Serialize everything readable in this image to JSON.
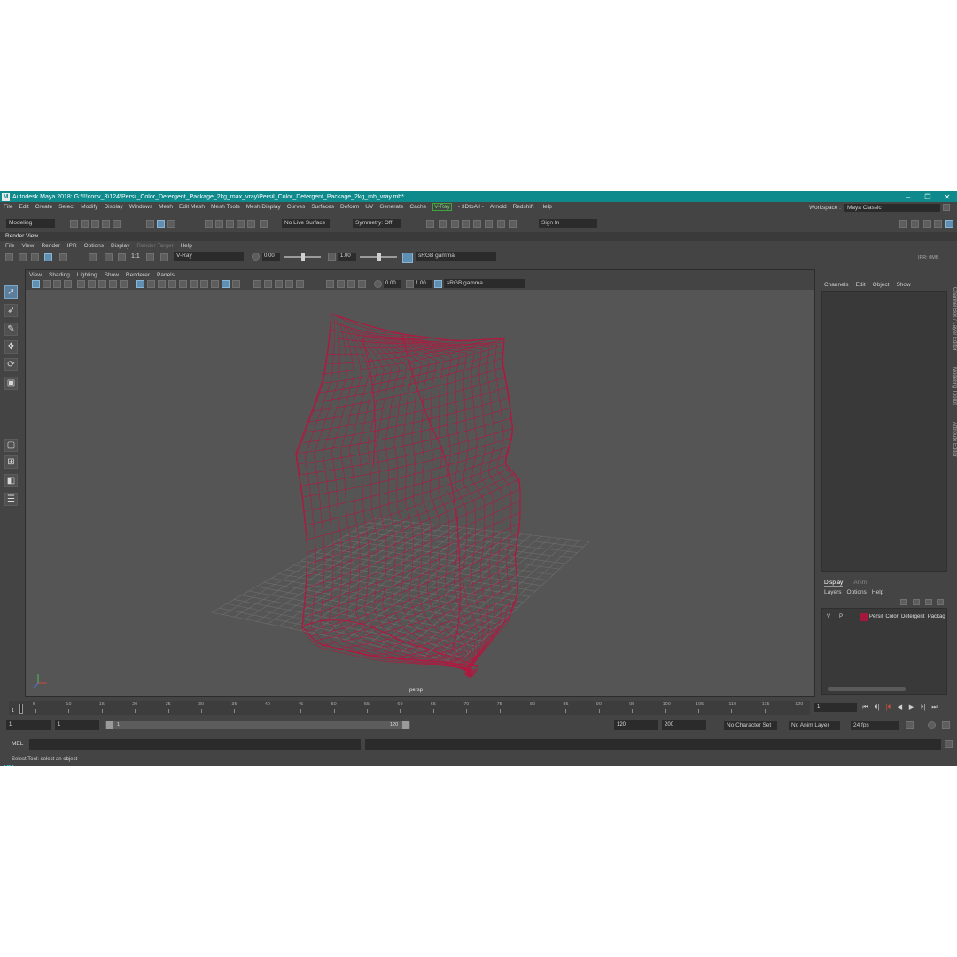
{
  "title_bar": {
    "logo": "M",
    "text": "Autodesk Maya 2018: G:\\!!!conv_3\\124\\Persil_Color_Detergent_Package_2kg_max_vray\\Persil_Color_Detergent_Package_2kg_mb_vray.mb*",
    "minimize": "–",
    "maximize": "❐",
    "close": "✕"
  },
  "menu_bar": {
    "items": [
      "File",
      "Edit",
      "Create",
      "Select",
      "Modify",
      "Display",
      "Windows",
      "Mesh",
      "Edit Mesh",
      "Mesh Tools",
      "Mesh Display",
      "Curves",
      "Surfaces",
      "Deform",
      "UV",
      "Generate",
      "Cache"
    ],
    "vray": "V-Ray",
    "items2": [
      "- 3DtoAll -",
      "Arnold",
      "Redshift",
      "Help"
    ]
  },
  "workspace": {
    "label": "Workspace :",
    "value": "Maya Classic"
  },
  "status_line": {
    "menu_set": "Modeling",
    "live_surface": "No Live Surface",
    "symmetry": "Symmetry: Off",
    "sign_in": "Sign In"
  },
  "render_view": {
    "title": "Render View",
    "menu": [
      "File",
      "View",
      "Render",
      "IPR",
      "Options",
      "Display"
    ],
    "menu_disabled": "Render Target",
    "menu_help": "Help",
    "ratio": "1:1",
    "renderer": "V-Ray",
    "exposure": "0.00",
    "gamma": "1.00",
    "color_space": "sRGB gamma",
    "ipr_label": "IPR: 0MB"
  },
  "viewport": {
    "menu": [
      "View",
      "Shading",
      "Lighting",
      "Show",
      "Renderer",
      "Panels"
    ],
    "exposure": "0.00",
    "gamma": "1.00",
    "color_space": "sRGB gamma",
    "camera_label": "persp",
    "wire_color": "#b5163f",
    "grid_color": "#6e6e6e",
    "axis_labels": {
      "x": "x",
      "y": "y",
      "z": "z"
    }
  },
  "right_panel": {
    "vertical_tabs": [
      "Channel Box / Layer Editor",
      "Modeling Toolkit",
      "Attribute Editor"
    ],
    "channel_menu": [
      "Channels",
      "Edit",
      "Object",
      "Show"
    ],
    "display_tabs": {
      "active": "Display",
      "inactive": "Anim"
    },
    "layer_menu": [
      "Layers",
      "Options",
      "Help"
    ],
    "layer": {
      "v": "V",
      "p": "P",
      "name": "Persil_Color_Detergent_Package",
      "color": "#a3163e"
    }
  },
  "timeline": {
    "tick_labels": [
      "5",
      "10",
      "15",
      "20",
      "25",
      "30",
      "35",
      "40",
      "45",
      "50",
      "55",
      "60",
      "65",
      "70",
      "75",
      "80",
      "85",
      "90",
      "95",
      "100",
      "105",
      "110",
      "115",
      "120"
    ],
    "playhead_frame": "1",
    "current_frame": "1",
    "playback_buttons": [
      "⏮",
      "⏴|",
      "|⏴",
      "◀",
      "▶",
      "⏵|",
      "⏭"
    ]
  },
  "range": {
    "start": "1",
    "anim_start": "1",
    "slider_start": "1",
    "slider_end": "120",
    "end": "120",
    "anim_end": "200",
    "character_set": "No Character Set",
    "anim_layer": "No Anim Layer",
    "fps": "24 fps"
  },
  "command_line": {
    "mel_label": "MEL"
  },
  "help_line": {
    "text": "Select Tool: select an object"
  }
}
